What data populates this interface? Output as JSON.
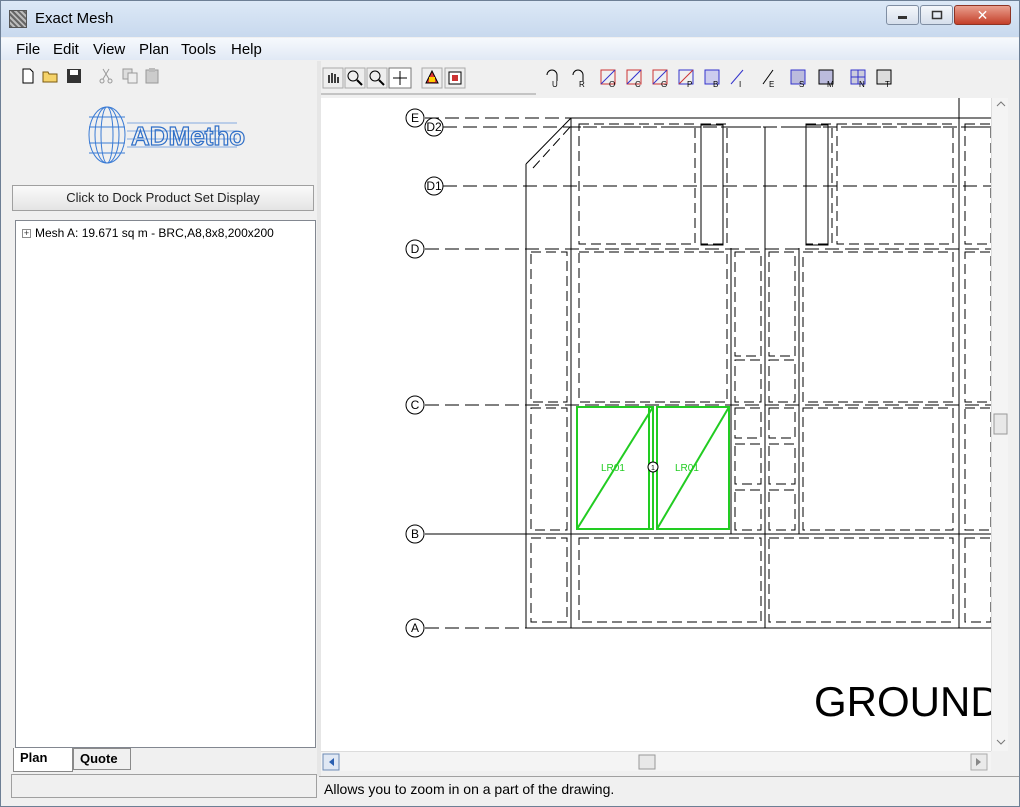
{
  "window": {
    "title": "Exact Mesh"
  },
  "menu": [
    "File",
    "Edit",
    "View",
    "Plan",
    "Tools",
    "Help"
  ],
  "left_panel": {
    "dock_button_label": "Click to Dock Product Set Display",
    "tree_item": "Mesh A: 19.671 sq m - BRC,A8,8x8,200x200",
    "tree_item_expand": "+",
    "tabs": [
      "Plan",
      "Quote"
    ],
    "logo_text": "CADMethods"
  },
  "toolbar": {
    "left_icons": [
      "new-file-icon",
      "open-folder-icon",
      "save-icon",
      "cut-icon",
      "copy-icon",
      "paste-icon"
    ],
    "view_icons": [
      "pan-hand-icon",
      "zoom-in-icon",
      "zoom-out-icon",
      "crosshair-icon",
      "layer-icon",
      "export-icon"
    ],
    "cad_letters": [
      "U",
      "R",
      "O",
      "C",
      "G",
      "P",
      "B",
      "I",
      "E",
      "S",
      "M",
      "N",
      "T"
    ]
  },
  "drawing": {
    "grid_labels": [
      "E",
      "D2",
      "D1",
      "D",
      "C",
      "B",
      "A"
    ],
    "mesh_labels": [
      "LR01",
      "LR01"
    ],
    "mesh_node": "1",
    "title_text": "GROUND",
    "mesh_color": "#22cc22"
  },
  "status": {
    "text": "Allows you to zoom in on a part of the drawing."
  }
}
